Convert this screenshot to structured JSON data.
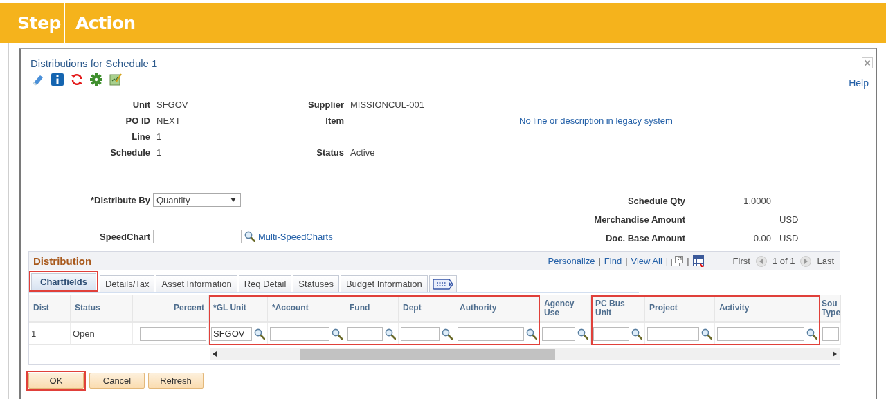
{
  "header": {
    "step": "Step",
    "action": "Action"
  },
  "dialog": {
    "title": "Distributions for Schedule 1",
    "help": "Help"
  },
  "info_rows": [
    {
      "label": "Unit",
      "value": "SFGOV",
      "right_label": "Supplier",
      "right_value": "MISSIONCUL-001"
    },
    {
      "label": "PO ID",
      "value": "NEXT",
      "right_label": "Item",
      "note": "No line or description in legacy system"
    },
    {
      "label": "Line",
      "value": "1"
    },
    {
      "label": "Schedule",
      "value": "1",
      "right_label": "Status",
      "right_value": "Active"
    }
  ],
  "distribute_by": {
    "label": "*Distribute By",
    "value": "Quantity"
  },
  "speedchart": {
    "label": "SpeedChart",
    "link": "Multi-SpeedCharts"
  },
  "amounts": [
    {
      "label": "Schedule Qty",
      "value": "1.0000"
    },
    {
      "label": "Merchandise Amount",
      "currency": "USD"
    },
    {
      "label": "Doc. Base Amount",
      "value": "0.00",
      "currency": "USD"
    }
  ],
  "distribution": {
    "title": "Distribution",
    "toolbar": [
      {
        "kind": "link",
        "label": "Personalize"
      },
      {
        "kind": "separator",
        "label": "|"
      },
      {
        "kind": "link",
        "label": "Find"
      },
      {
        "kind": "separator",
        "label": "|"
      },
      {
        "kind": "link",
        "label": "View All"
      },
      {
        "kind": "separator",
        "label": "|"
      },
      {
        "kind": "zoom"
      },
      {
        "kind": "separator",
        "label": "|"
      },
      {
        "kind": "download"
      }
    ],
    "nav": {
      "first": "First",
      "count": "1 of 1",
      "last": "Last"
    },
    "tabs": [
      {
        "label": "Chartfields",
        "selected": true,
        "highlighted": true
      },
      {
        "label": "Details/Tax",
        "selected": false,
        "highlighted": false
      },
      {
        "label": "Asset Information",
        "selected": false,
        "highlighted": false
      },
      {
        "label": "Req Detail",
        "selected": false,
        "highlighted": false
      },
      {
        "label": "Statuses",
        "selected": false,
        "highlighted": false
      },
      {
        "label": "Budget Information",
        "selected": false,
        "highlighted": false
      }
    ],
    "columns": [
      {
        "label": "Dist",
        "highlighted": false
      },
      {
        "label": "Status",
        "highlighted": false
      },
      {
        "label": "Percent",
        "highlighted": false
      },
      {
        "label": "*GL Unit",
        "highlighted": true
      },
      {
        "label": "*Account",
        "highlighted": true
      },
      {
        "label": "Fund",
        "highlighted": true
      },
      {
        "label": "Dept",
        "highlighted": true
      },
      {
        "label": "Authority",
        "highlighted": true
      },
      {
        "label": "Agency Use",
        "highlighted": false
      },
      {
        "label": "PC Bus Unit",
        "highlighted": true
      },
      {
        "label": "Project",
        "highlighted": true
      },
      {
        "label": "Activity",
        "highlighted": true
      },
      {
        "label": "Sou Type",
        "highlighted": false
      }
    ],
    "rows": [
      {
        "cells": [
          {
            "kind": "text",
            "value": "1"
          },
          {
            "kind": "text",
            "value": "Open"
          },
          {
            "kind": "input"
          },
          {
            "kind": "lookup",
            "value": "SFGOV"
          },
          {
            "kind": "lookup"
          },
          {
            "kind": "lookup"
          },
          {
            "kind": "lookup"
          },
          {
            "kind": "lookup"
          },
          {
            "kind": "lookup"
          },
          {
            "kind": "lookup"
          },
          {
            "kind": "lookup"
          },
          {
            "kind": "lookup"
          },
          {
            "kind": "input"
          }
        ]
      }
    ]
  },
  "buttons": [
    {
      "label": "OK",
      "highlighted": true
    },
    {
      "label": "Cancel",
      "highlighted": false
    },
    {
      "label": "Refresh",
      "highlighted": false
    }
  ]
}
